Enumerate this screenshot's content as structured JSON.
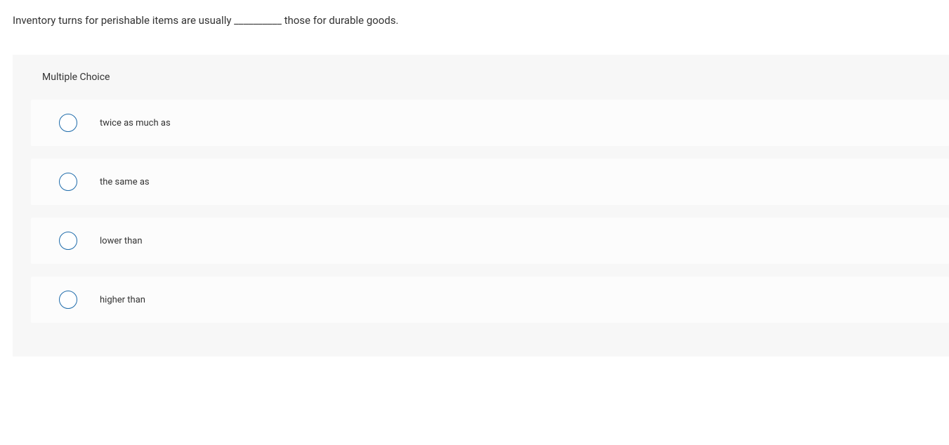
{
  "question": {
    "text": "Inventory turns for perishable items are usually __________ those for durable goods."
  },
  "quiz": {
    "header": "Multiple Choice",
    "options": [
      {
        "label": "twice as much as"
      },
      {
        "label": "the same as"
      },
      {
        "label": "lower than"
      },
      {
        "label": "higher than"
      }
    ]
  }
}
